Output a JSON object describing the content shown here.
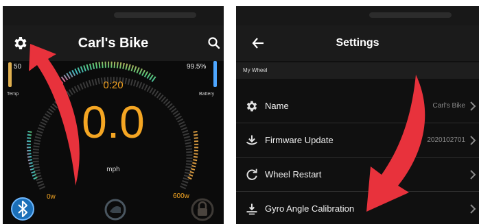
{
  "dashboard": {
    "title": "Carl's Bike",
    "timer": "0:20",
    "speed": "0.0",
    "speed_unit": "mph",
    "temp_value": "50",
    "temp_label": "Temp",
    "battery_value": "99.5%",
    "battery_label": "Battery",
    "power_min": "0w",
    "power_max": "600w",
    "icons": [
      "gear-icon",
      "search-icon",
      "bluetooth-icon",
      "helmet-icon",
      "lock-icon"
    ],
    "colors": {
      "accent": "#f5a623",
      "battery": "#4da6ff",
      "arrow": "#e8323c"
    }
  },
  "settings": {
    "title": "Settings",
    "back_icon": "arrow-left-icon",
    "section": "My Wheel",
    "rows": [
      {
        "label": "Name",
        "value": "Carl's Bike",
        "icon": "gear-icon"
      },
      {
        "label": "Firmware Update",
        "value": "2020102701",
        "icon": "download-icon"
      },
      {
        "label": "Wheel Restart",
        "value": "",
        "icon": "restart-icon"
      },
      {
        "label": "Gyro Angle Calibration",
        "value": "",
        "icon": "calibration-icon"
      }
    ]
  }
}
